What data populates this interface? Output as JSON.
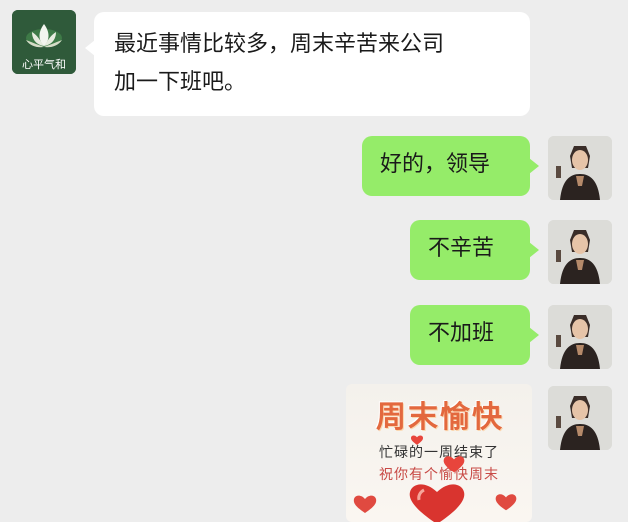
{
  "contact": {
    "avatar_label": "心平气和",
    "message_lines": [
      "最近事情比较多，周末辛苦来公司",
      "加一下班吧。"
    ]
  },
  "replies": [
    "好的，领导",
    "不辛苦",
    "不加班"
  ],
  "sticker": {
    "title": "周末愉快",
    "line1": "忙碌的一周结束了",
    "line2": "祝你有个愉快周末"
  },
  "colors": {
    "chat_background": "#ededed",
    "sent_bubble": "#95ec69",
    "received_bubble": "#ffffff",
    "sticker_title": "#e3683e"
  },
  "icons": [
    "lotus-avatar-icon",
    "person-avatar-icon",
    "heart-icon"
  ]
}
